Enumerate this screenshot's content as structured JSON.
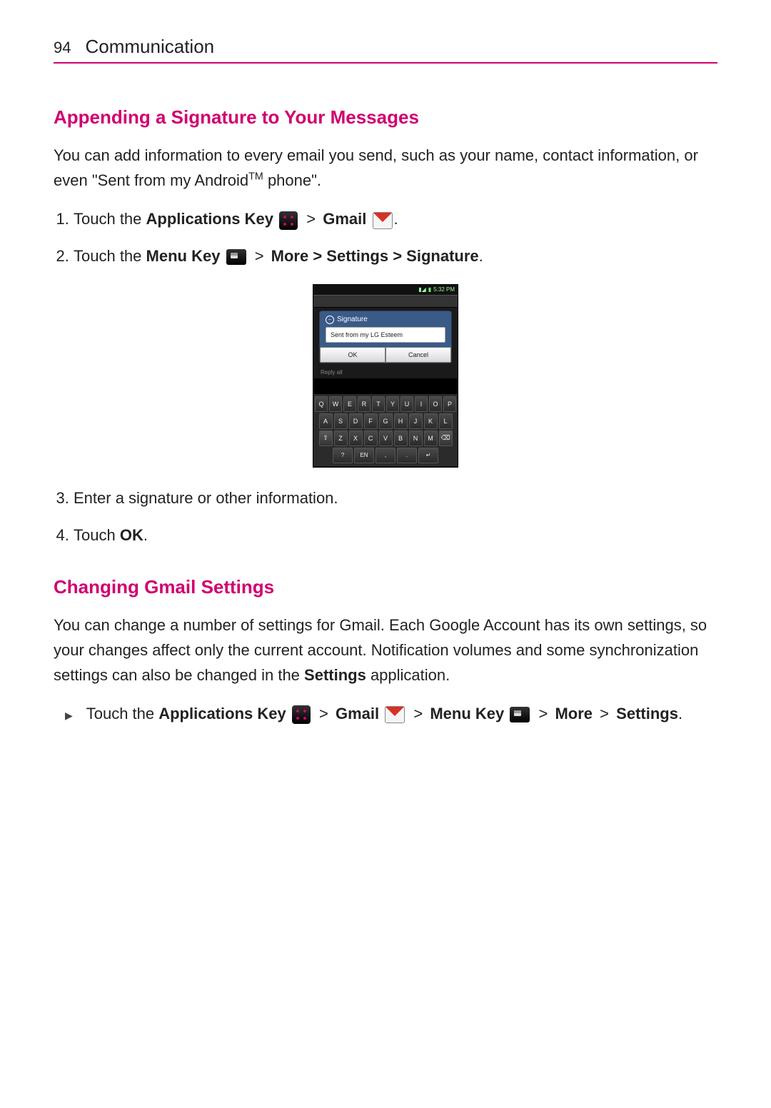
{
  "page": {
    "number": "94",
    "header": "Communication"
  },
  "section1": {
    "heading": "Appending a Signature to Your Messages",
    "intro_pre": "You can add information to every email you send, such as your name, contact information, or even \"Sent from my Android",
    "intro_tm": "TM",
    "intro_post": " phone\".",
    "step1_pre": "Touch the ",
    "step1_appkey": "Applications Key",
    "step1_gmail": "Gmail",
    "step2_pre": "Touch the ",
    "step2_menukey": "Menu Key",
    "step2_chain": "More > Settings > Signature",
    "step3": "Enter a signature or other information.",
    "step4_pre": "Touch ",
    "step4_ok": "OK"
  },
  "phone": {
    "status_time": "5:32 PM",
    "dialog_title": "Signature",
    "input_value": "Sent from my LG Esteem",
    "btn_ok": "OK",
    "btn_cancel": "Cancel",
    "textline": "Reply all",
    "rows": [
      [
        "Q",
        "W",
        "E",
        "R",
        "T",
        "Y",
        "U",
        "I",
        "O",
        "P"
      ],
      [
        "A",
        "S",
        "D",
        "F",
        "G",
        "H",
        "J",
        "K",
        "L"
      ],
      [
        "⇧",
        "Z",
        "X",
        "C",
        "V",
        "B",
        "N",
        "M",
        "⌫"
      ],
      [
        "?",
        "EN",
        ",",
        ".",
        "↵"
      ]
    ]
  },
  "section2": {
    "heading": "Changing Gmail Settings",
    "intro_a": "You can change a number of settings for Gmail. Each Google Account has its own settings, so your changes affect only the current account. Notification volumes and some synchronization settings can also be changed in the ",
    "intro_settings": "Settings",
    "intro_b": " application.",
    "bullet_pre": "Touch the ",
    "bullet_appkey": "Applications Key",
    "bullet_gmail": "Gmail",
    "bullet_menukey": "Menu Key",
    "bullet_more": "More",
    "bullet_settings": "Settings"
  },
  "glyphs": {
    "gt": ">"
  }
}
